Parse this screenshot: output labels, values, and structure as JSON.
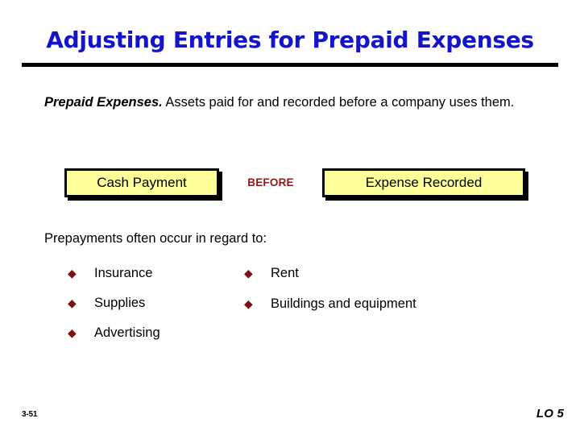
{
  "slide": {
    "title": "Adjusting Entries for Prepaid Expenses",
    "title_color": "#1414c8",
    "background_color": "#ffffff"
  },
  "lead": {
    "term": "Prepaid Expenses.",
    "text": " Assets paid for and recorded before a company uses them."
  },
  "flow": {
    "left_box_label": "Cash Payment",
    "connector_label": "BEFORE",
    "right_box_label": "Expense Recorded",
    "box_fill_color": "#ffff99",
    "box_border_color": "#000000",
    "connector_color": "#8b1a1a"
  },
  "sub_lead": "Prepayments often occur in regard to:",
  "bullets": {
    "marker_glyph": "◆",
    "marker_color": "#7b1113",
    "left_column": [
      {
        "label": "Insurance"
      },
      {
        "label": "Supplies"
      },
      {
        "label": "Advertising"
      }
    ],
    "right_column": [
      {
        "label": "Rent"
      },
      {
        "label": "Buildings and equipment"
      }
    ]
  },
  "footer": {
    "slide_number": "3-51",
    "objective": "LO 5"
  }
}
